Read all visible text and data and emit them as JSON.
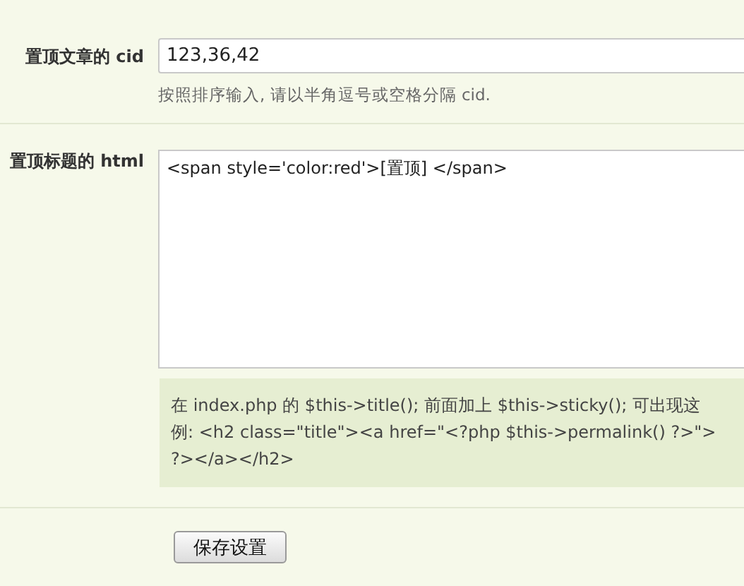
{
  "fields": [
    {
      "kind": "input",
      "label": "置顶文章的 cid",
      "value": "123,36,42",
      "hint": "按照排序输入, 请以半角逗号或空格分隔 cid."
    },
    {
      "kind": "textarea",
      "label": "置顶标题的 html",
      "value": "<span style='color:red'>[置顶] </span>",
      "note_lines": [
        "在 index.php 的 $this->title(); 前面加上 $this->sticky(); 可出现这",
        "例: <h2 class=\"title\"><a href=\"<?php $this->permalink() ?>\">",
        "?></a></h2>"
      ]
    }
  ],
  "save_button": "保存设置"
}
